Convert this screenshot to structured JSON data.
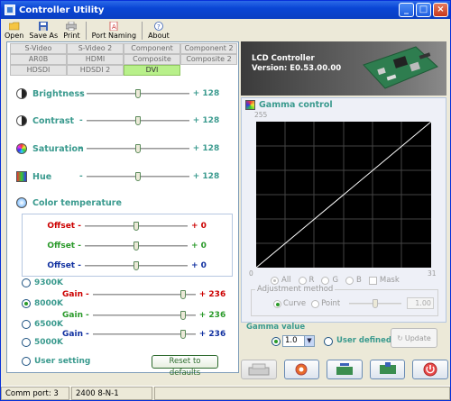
{
  "window": {
    "title": "Controller Utility"
  },
  "toolbar": {
    "open": "Open",
    "save_as": "Save As",
    "print": "Print",
    "port_naming": "Port Naming",
    "about": "About"
  },
  "tabs": [
    [
      "S-Video",
      "S-Video 2",
      "Component",
      "Component 2"
    ],
    [
      "AR0B",
      "HDMI",
      "Composite",
      "Composite 2"
    ],
    [
      "HDSDI",
      "HDSDI 2",
      "DVI",
      ""
    ]
  ],
  "active_tab": "DVI",
  "adjustments": [
    {
      "label": "Brightness",
      "value": "+ 128",
      "level": 0.5
    },
    {
      "label": "Contrast",
      "value": "+ 128",
      "level": 0.5
    },
    {
      "label": "Saturation",
      "value": "+ 128",
      "level": 0.5
    },
    {
      "label": "Hue",
      "value": "+ 128",
      "level": 0.5
    }
  ],
  "color_temperature": {
    "label": "Color temperature",
    "offsets": [
      {
        "label": "Offset",
        "value": "+ 0",
        "color": "#cc0000"
      },
      {
        "label": "Offset",
        "value": "+ 0",
        "color": "#2a9a2a"
      },
      {
        "label": "Offset",
        "value": "+ 0",
        "color": "#1030a0"
      }
    ],
    "presets": [
      "9300K",
      "8000K",
      "6500K",
      "5000K"
    ],
    "selected_preset": "8000K",
    "gains": [
      {
        "label": "Gain",
        "value": "+ 236",
        "color": "#cc0000",
        "level": 0.9
      },
      {
        "label": "Gain",
        "value": "+ 236",
        "color": "#2a9a2a",
        "level": 0.9
      },
      {
        "label": "Gain",
        "value": "+ 236",
        "color": "#1030a0",
        "level": 0.9
      }
    ],
    "user_setting": "User setting",
    "reset_button": "Reset to defaults"
  },
  "banner": {
    "line1": "LCD Controller",
    "line2": "Version: E0.53.00.00"
  },
  "gamma": {
    "label": "Gamma control",
    "y_max": "255",
    "x_min": "0",
    "x_max": "31",
    "channels": [
      "All",
      "R",
      "G",
      "B"
    ],
    "selected_channel": "All",
    "mask": "Mask",
    "adjustment_method": "Adjustment method",
    "methods": [
      "Curve",
      "Point"
    ],
    "selected_method": "Curve",
    "point_value": "1.00",
    "value_label": "Gamma value",
    "value": "1.0",
    "user_defined": "User defined",
    "update_button": "Update"
  },
  "status": {
    "port": "Comm port: 3",
    "settings": "2400 8-N-1"
  },
  "colors": {
    "accent_teal": "#3a9a8e",
    "title_blue": "#0a46d5"
  }
}
